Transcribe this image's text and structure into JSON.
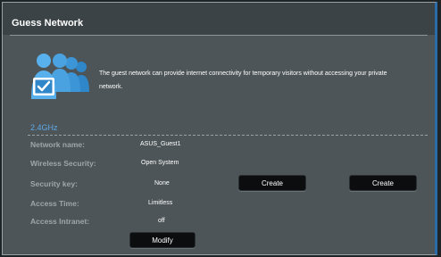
{
  "header": {
    "title": "Guess Network"
  },
  "intro": {
    "icon": "guest-users-icon",
    "text": "The guest network can provide internet connectivity for temporary visitors without accessing your private network."
  },
  "band": {
    "label": "2.4GHz"
  },
  "fields": {
    "network_name": {
      "label": "Network name:",
      "value": "ASUS_Guest1"
    },
    "wireless_security": {
      "label": "Wireless Security:",
      "value": "Open System"
    },
    "security_key": {
      "label": "Security key:",
      "value": "None"
    },
    "access_time": {
      "label": "Access Time:",
      "value": "Limitless"
    },
    "access_intranet": {
      "label": "Access Intranet:",
      "value": "off"
    }
  },
  "buttons": {
    "create_1": "Create",
    "create_2": "Create",
    "modify": "Modify"
  },
  "colors": {
    "accent": "#5ea8e8",
    "panel": "#4d5558",
    "button": "#0c0d0e"
  }
}
